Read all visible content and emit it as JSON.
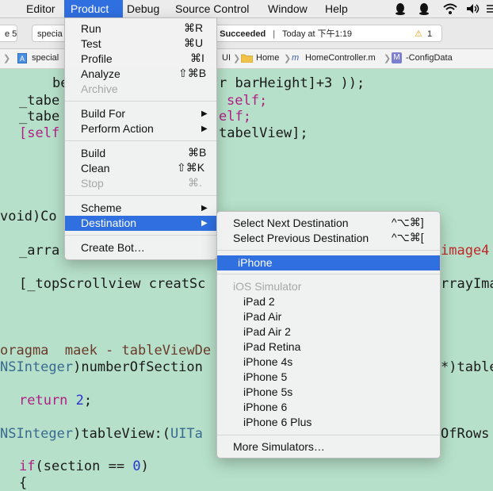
{
  "menubar": {
    "items": [
      "Editor",
      "Product",
      "Debug",
      "Source Control",
      "Window",
      "Help"
    ],
    "active": "Product"
  },
  "toolbar": {
    "scheme_partial": "e 5",
    "target_partial": "specia",
    "status_prefix": ": ",
    "status_bold": "Succeeded",
    "status_sep": "|",
    "status_time": "Today at 下午1:19",
    "warning_count": "1",
    "warning_icon": "⚠"
  },
  "jumpbar": {
    "crumbs": [
      "special",
      "UI",
      "Home",
      "HomeController.m",
      "-ConfigData"
    ],
    "file_icon": "m",
    "method_icon": "M"
  },
  "code_lines": {
    "l1a": "be",
    "l1b": "r barHeight]+3 ));",
    "l2a": "_tabe",
    "l2b": "self;",
    "l3a": "_tabe",
    "l3b": "elf;",
    "l4a": "[self",
    "l4b": "tabelView];",
    "l5a": "void)Co",
    "l6a": "_arra",
    "l6b": "image4",
    "l7a": "[_topScrollview creatSc",
    "l7b": "rrayIma",
    "l8": "oragma  maek - tableViewDe",
    "l9a": "NSInteger",
    "l9b": ")numberOfSection",
    "l9c": "*)table",
    "l10a": "return",
    "l10b": "2",
    "l11a": "NSInteger",
    "l11b": ")tableView:(",
    "l11c": "UITa",
    "l11d": "OfRows",
    "l12a": "if",
    "l12b": "(section == ",
    "l12c": "0",
    "l12d": ")",
    "l13": "{"
  },
  "product_menu": {
    "items": [
      {
        "label": "Run",
        "shortcut": "⌘R"
      },
      {
        "label": "Test",
        "shortcut": "⌘U"
      },
      {
        "label": "Profile",
        "shortcut": "⌘I"
      },
      {
        "label": "Analyze",
        "shortcut": "⇧⌘B"
      },
      {
        "label": "Archive",
        "shortcut": ""
      },
      {
        "label": "Build For",
        "shortcut": ""
      },
      {
        "label": "Perform Action",
        "shortcut": ""
      },
      {
        "label": "Build",
        "shortcut": "⌘B"
      },
      {
        "label": "Clean",
        "shortcut": "⇧⌘K"
      },
      {
        "label": "Stop",
        "shortcut": "⌘."
      },
      {
        "label": "Scheme",
        "shortcut": ""
      },
      {
        "label": "Destination",
        "shortcut": ""
      },
      {
        "label": "Create Bot…",
        "shortcut": ""
      }
    ]
  },
  "destination_menu": {
    "select_next": "Select Next Destination",
    "select_next_shortcut": "^⌥⌘]",
    "select_prev": "Select Previous Destination",
    "select_prev_shortcut": "^⌥⌘[",
    "selected": "iPhone",
    "section_header": "iOS Simulator",
    "simulators": [
      "iPad 2",
      "iPad Air",
      "iPad Air 2",
      "iPad Retina",
      "iPhone 4s",
      "iPhone 5",
      "iPhone 5s",
      "iPhone 6",
      "iPhone 6 Plus"
    ],
    "more": "More Simulators…"
  }
}
